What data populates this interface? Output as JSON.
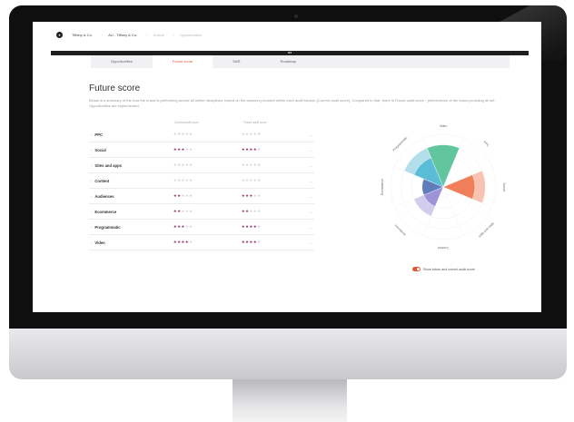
{
  "header": {
    "breadcrumbs": [
      "Tiffany & Co.",
      "AU - Tiffany & Co.",
      "Unlock",
      "Opportunities"
    ],
    "darkbar_label": "MB"
  },
  "tabs": [
    {
      "label": "Opportunities",
      "active": false
    },
    {
      "label": "Future score",
      "active": true
    },
    {
      "label": "SAR",
      "active": false
    },
    {
      "label": "Roadmap",
      "active": false
    }
  ],
  "page": {
    "title": "Future score",
    "description": "Below is a summary of the how the brand is performing across all online disciplines, based on the answers provided within each audit section (Current audit score). Compared to that, there is Future audit score - performance of the brand providing all set Opportunities are implemented."
  },
  "table": {
    "col_current": "Current audit score",
    "col_future": "Future audit score",
    "rows": [
      {
        "label": "PPC",
        "current": 0,
        "future": 0
      },
      {
        "label": "Social",
        "current": 3,
        "future": 4
      },
      {
        "label": "Sites and apps",
        "current": 0,
        "future": 0
      },
      {
        "label": "Content",
        "current": 0,
        "future": 0
      },
      {
        "label": "Audiences",
        "current": 2,
        "future": 3
      },
      {
        "label": "Ecommerce",
        "current": 2,
        "future": 2
      },
      {
        "label": "Programmatic",
        "current": 3,
        "future": 4
      },
      {
        "label": "Video",
        "current": 4,
        "future": 4
      }
    ]
  },
  "chart_data": {
    "type": "polar-area",
    "categories": [
      "Video",
      "PPC",
      "Social",
      "Sites and apps",
      "Content",
      "Audiences",
      "Ecommerce",
      "Programmatic"
    ],
    "future": [
      4,
      0,
      4,
      0,
      0,
      3,
      2,
      4
    ],
    "current": [
      4,
      0,
      3,
      0,
      0,
      2,
      2,
      3
    ],
    "max": 5,
    "colors": [
      "#5dc39b",
      "#f59a73",
      "#ef7a54",
      "#cccccc",
      "#cccccc",
      "#9c8fd6",
      "#5b78b8",
      "#56b9d6"
    ]
  },
  "toggle": {
    "label": "Show future and current audit score",
    "on": true
  }
}
